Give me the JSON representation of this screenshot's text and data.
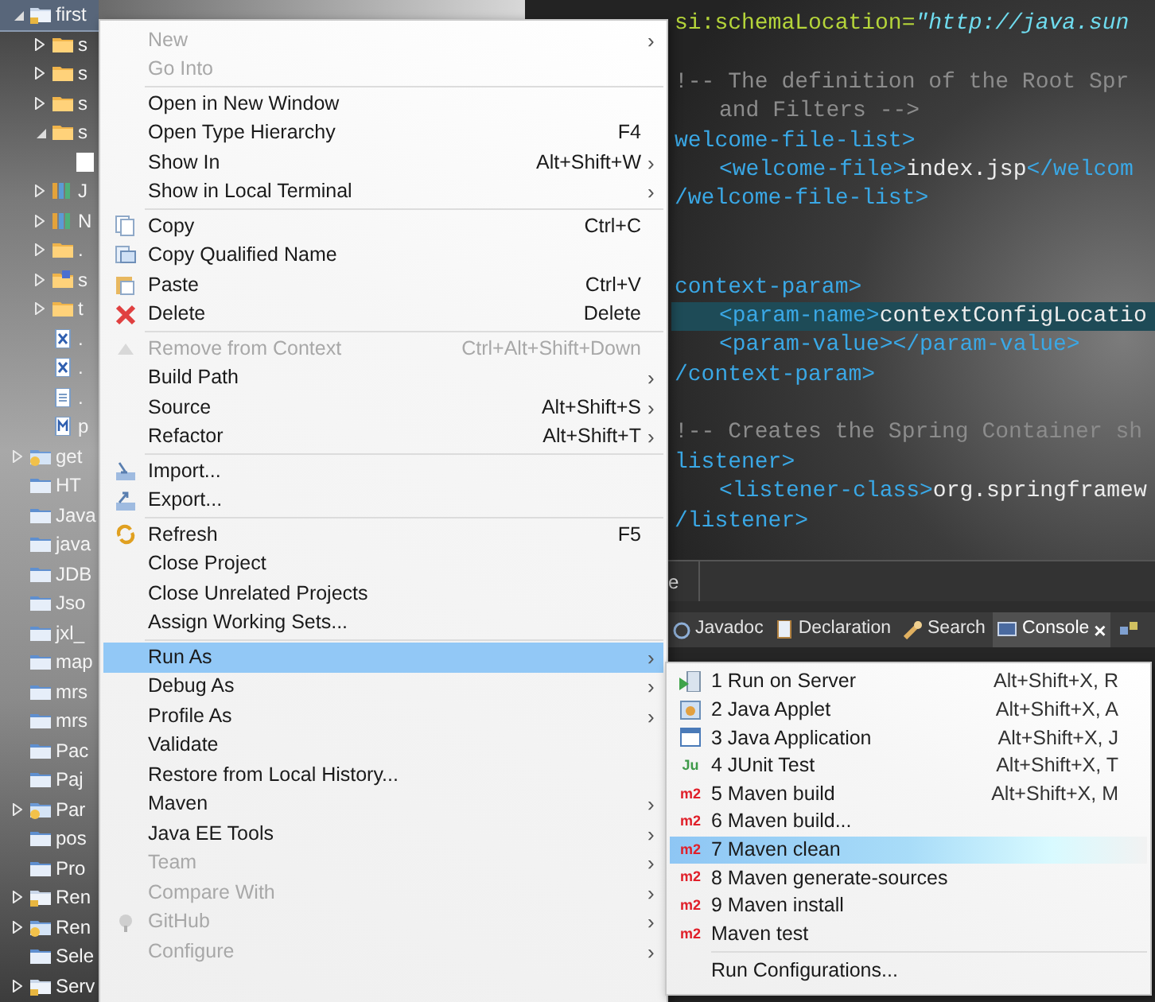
{
  "project_explorer": {
    "items": [
      {
        "label": "first",
        "kind": "project",
        "selected": true,
        "expanded": true,
        "children": [
          {
            "label": "s",
            "kind": "folder",
            "selected": false,
            "expanded": false
          },
          {
            "label": "s",
            "kind": "folder",
            "selected": false,
            "expanded": false
          },
          {
            "label": "s",
            "kind": "folder",
            "selected": false,
            "expanded": false
          },
          {
            "label": "s",
            "kind": "folder",
            "selected": false,
            "expanded": true,
            "children": [
              {
                "kind": "blank",
                "selected": false
              }
            ]
          },
          {
            "label": "J",
            "kind": "library",
            "selected": false,
            "expanded": false
          },
          {
            "label": "N",
            "kind": "library",
            "selected": false,
            "expanded": false
          },
          {
            "label": ".",
            "kind": "folder",
            "selected": false,
            "expanded": false
          },
          {
            "label": "s",
            "kind": "source",
            "selected": false,
            "expanded": false
          },
          {
            "label": "t",
            "kind": "folder",
            "selected": false,
            "expanded": false
          },
          {
            "label": ".",
            "kind": "xml",
            "selected": false
          },
          {
            "label": ".",
            "kind": "xml",
            "selected": false
          },
          {
            "label": ".",
            "kind": "text",
            "selected": false
          },
          {
            "label": "p",
            "kind": "pom",
            "selected": false
          }
        ]
      },
      {
        "label": "get",
        "kind": "maven",
        "selected": false,
        "expanded": false
      },
      {
        "label": "HT",
        "kind": "closed",
        "selected": false
      },
      {
        "label": "Java",
        "kind": "closed",
        "selected": false
      },
      {
        "label": "java",
        "kind": "closed",
        "selected": false
      },
      {
        "label": "JDB",
        "kind": "closed",
        "selected": false
      },
      {
        "label": "Jso",
        "kind": "closed",
        "selected": false
      },
      {
        "label": "jxl_",
        "kind": "closed",
        "selected": false
      },
      {
        "label": "map",
        "kind": "closed",
        "selected": false
      },
      {
        "label": "mrs",
        "kind": "closed",
        "selected": false
      },
      {
        "label": "mrs",
        "kind": "closed",
        "selected": false
      },
      {
        "label": "Pac",
        "kind": "closed",
        "selected": false
      },
      {
        "label": "Paj",
        "kind": "closed",
        "selected": false
      },
      {
        "label": "Par",
        "kind": "maven",
        "selected": false,
        "expanded": false
      },
      {
        "label": "pos",
        "kind": "closed",
        "selected": false
      },
      {
        "label": "Pro",
        "kind": "closed",
        "selected": false
      },
      {
        "label": "Ren",
        "kind": "project",
        "selected": false,
        "expanded": false
      },
      {
        "label": "Ren",
        "kind": "maven",
        "selected": false,
        "expanded": false
      },
      {
        "label": "Sele",
        "kind": "closed",
        "selected": false
      },
      {
        "label": "Serv",
        "kind": "project",
        "selected": false,
        "expanded": false
      }
    ]
  },
  "editor": {
    "lines": [
      {
        "kind": "code",
        "highlighted": false,
        "indented": false,
        "segments": [
          {
            "kind": "attr",
            "text": "si:schemaLocation="
          },
          {
            "kind": "value",
            "text": "\"http://java.sun"
          }
        ]
      },
      {
        "kind": "blank"
      },
      {
        "kind": "code",
        "highlighted": false,
        "indented": false,
        "segments": [
          {
            "kind": "comment",
            "text": "!-- The definition of the Root Spr"
          }
        ]
      },
      {
        "kind": "code",
        "highlighted": false,
        "indented": true,
        "segments": [
          {
            "kind": "comment",
            "text": "and Filters -->"
          }
        ]
      },
      {
        "kind": "code",
        "highlighted": false,
        "indented": false,
        "segments": [
          {
            "kind": "tag",
            "text": "welcome-file-list>"
          }
        ]
      },
      {
        "kind": "code",
        "highlighted": false,
        "indented": true,
        "segments": [
          {
            "kind": "tag",
            "text": "<welcome-file>"
          },
          {
            "kind": "text",
            "text": "index.jsp"
          },
          {
            "kind": "tag",
            "text": "</welcom"
          }
        ]
      },
      {
        "kind": "code",
        "highlighted": false,
        "indented": false,
        "segments": [
          {
            "kind": "tag",
            "text": "/welcome-file-list>"
          }
        ]
      },
      {
        "kind": "blank"
      },
      {
        "kind": "blank"
      },
      {
        "kind": "code",
        "highlighted": false,
        "indented": false,
        "segments": [
          {
            "kind": "tag",
            "text": "context-param>"
          }
        ]
      },
      {
        "kind": "code",
        "highlighted": true,
        "indented": true,
        "segments": [
          {
            "kind": "tag",
            "text": "<param-name>"
          },
          {
            "kind": "text",
            "text": "contextConfigLocatio"
          }
        ]
      },
      {
        "kind": "code",
        "highlighted": false,
        "indented": true,
        "segments": [
          {
            "kind": "tag",
            "text": "<param-value></param-value>"
          }
        ]
      },
      {
        "kind": "code",
        "highlighted": false,
        "indented": false,
        "segments": [
          {
            "kind": "tag",
            "text": "/context-param>"
          }
        ]
      },
      {
        "kind": "blank"
      },
      {
        "kind": "code",
        "highlighted": false,
        "indented": false,
        "segments": [
          {
            "kind": "comment",
            "text": "!-- Creates the Spring Container sh"
          }
        ]
      },
      {
        "kind": "code",
        "highlighted": false,
        "indented": false,
        "segments": [
          {
            "kind": "tag",
            "text": "listener>"
          }
        ]
      },
      {
        "kind": "code",
        "highlighted": false,
        "indented": true,
        "segments": [
          {
            "kind": "tag",
            "text": "<listener-class>"
          },
          {
            "kind": "text",
            "text": "org.springframew"
          }
        ]
      },
      {
        "kind": "code",
        "highlighted": false,
        "indented": false,
        "segments": [
          {
            "kind": "tag",
            "text": "/listener>"
          }
        ]
      }
    ],
    "tabs": [
      {
        "label": "e",
        "selected": false
      }
    ]
  },
  "bottom_panel": {
    "tabs": [
      {
        "label": "Javadoc",
        "selected": false,
        "closable": false
      },
      {
        "label": "Declaration",
        "selected": false,
        "closable": false
      },
      {
        "label": "Search",
        "selected": false,
        "closable": false
      },
      {
        "label": "Console",
        "selected": true,
        "closable": true
      }
    ],
    "close_mark": "×"
  },
  "context_menu": {
    "arrow": "›",
    "items": [
      {
        "kind": "item",
        "label": "New",
        "disabled": true,
        "submenu": true,
        "selected": false
      },
      {
        "kind": "item",
        "label": "Go Into",
        "disabled": true,
        "submenu": false,
        "selected": false
      },
      {
        "kind": "separator"
      },
      {
        "kind": "item",
        "label": "Open in New Window",
        "disabled": false,
        "submenu": false,
        "selected": false
      },
      {
        "kind": "item",
        "label": "Open Type Hierarchy",
        "shortcut": "F4",
        "disabled": false,
        "submenu": false,
        "selected": false
      },
      {
        "kind": "item",
        "label": "Show In",
        "shortcut": "Alt+Shift+W",
        "disabled": false,
        "submenu": true,
        "selected": false
      },
      {
        "kind": "item",
        "label": "Show in Local Terminal",
        "disabled": false,
        "submenu": true,
        "selected": false
      },
      {
        "kind": "separator"
      },
      {
        "kind": "item",
        "label": "Copy",
        "shortcut": "Ctrl+C",
        "disabled": false,
        "submenu": false,
        "selected": false
      },
      {
        "kind": "item",
        "label": "Copy Qualified Name",
        "disabled": false,
        "submenu": false,
        "selected": false
      },
      {
        "kind": "item",
        "label": "Paste",
        "shortcut": "Ctrl+V",
        "disabled": false,
        "submenu": false,
        "selected": false
      },
      {
        "kind": "item",
        "label": "Delete",
        "shortcut": "Delete",
        "disabled": false,
        "submenu": false,
        "selected": false
      },
      {
        "kind": "separator"
      },
      {
        "kind": "item",
        "label": "Remove from Context",
        "shortcut": "Ctrl+Alt+Shift+Down",
        "disabled": true,
        "submenu": false,
        "selected": false
      },
      {
        "kind": "item",
        "label": "Build Path",
        "disabled": false,
        "submenu": true,
        "selected": false
      },
      {
        "kind": "item",
        "label": "Source",
        "shortcut": "Alt+Shift+S",
        "disabled": false,
        "submenu": true,
        "selected": false
      },
      {
        "kind": "item",
        "label": "Refactor",
        "shortcut": "Alt+Shift+T",
        "disabled": false,
        "submenu": true,
        "selected": false
      },
      {
        "kind": "separator"
      },
      {
        "kind": "item",
        "label": "Import...",
        "disabled": false,
        "submenu": false,
        "selected": false
      },
      {
        "kind": "item",
        "label": "Export...",
        "disabled": false,
        "submenu": false,
        "selected": false
      },
      {
        "kind": "separator"
      },
      {
        "kind": "item",
        "label": "Refresh",
        "shortcut": "F5",
        "disabled": false,
        "submenu": false,
        "selected": false
      },
      {
        "kind": "item",
        "label": "Close Project",
        "disabled": false,
        "submenu": false,
        "selected": false
      },
      {
        "kind": "item",
        "label": "Close Unrelated Projects",
        "disabled": false,
        "submenu": false,
        "selected": false
      },
      {
        "kind": "item",
        "label": "Assign Working Sets...",
        "disabled": false,
        "submenu": false,
        "selected": false
      },
      {
        "kind": "separator"
      },
      {
        "kind": "item",
        "label": "Run As",
        "disabled": false,
        "submenu": true,
        "selected": true
      },
      {
        "kind": "item",
        "label": "Debug As",
        "disabled": false,
        "submenu": true,
        "selected": false
      },
      {
        "kind": "item",
        "label": "Profile As",
        "disabled": false,
        "submenu": true,
        "selected": false
      },
      {
        "kind": "item",
        "label": "Validate",
        "disabled": false,
        "submenu": false,
        "selected": false
      },
      {
        "kind": "item",
        "label": "Restore from Local History...",
        "disabled": false,
        "submenu": false,
        "selected": false
      },
      {
        "kind": "item",
        "label": "Maven",
        "disabled": false,
        "submenu": true,
        "selected": false
      },
      {
        "kind": "item",
        "label": "Java EE Tools",
        "disabled": false,
        "submenu": true,
        "selected": false
      },
      {
        "kind": "item",
        "label": "Team",
        "disabled": true,
        "submenu": true,
        "selected": false
      },
      {
        "kind": "item",
        "label": "Compare With",
        "disabled": true,
        "submenu": true,
        "selected": false
      },
      {
        "kind": "item",
        "label": "GitHub",
        "disabled": true,
        "submenu": true,
        "selected": false
      },
      {
        "kind": "item",
        "label": "Configure",
        "disabled": true,
        "submenu": true,
        "selected": false
      }
    ]
  },
  "run_as_submenu": {
    "items": [
      {
        "kind": "item",
        "label": "1 Run on Server",
        "shortcut": "Alt+Shift+X, R",
        "selected": false
      },
      {
        "kind": "item",
        "label": "2 Java Applet",
        "shortcut": "Alt+Shift+X, A",
        "selected": false
      },
      {
        "kind": "item",
        "label": "3 Java Application",
        "shortcut": "Alt+Shift+X, J",
        "selected": false
      },
      {
        "kind": "item",
        "label": "4 JUnit Test",
        "shortcut": "Alt+Shift+X, T",
        "badge": "Ju",
        "selected": false
      },
      {
        "kind": "item",
        "label": "5 Maven build",
        "shortcut": "Alt+Shift+X, M",
        "badge": "m2",
        "selected": false
      },
      {
        "kind": "item",
        "label": "6 Maven build...",
        "badge": "m2",
        "selected": false
      },
      {
        "kind": "item",
        "label": "7 Maven clean",
        "badge": "m2",
        "selected": true
      },
      {
        "kind": "item",
        "label": "8 Maven generate-sources",
        "badge": "m2",
        "selected": false
      },
      {
        "kind": "item",
        "label": "9 Maven install",
        "badge": "m2",
        "selected": false
      },
      {
        "kind": "item",
        "label": "Maven test",
        "badge": "m2",
        "selected": false
      },
      {
        "kind": "separator"
      },
      {
        "kind": "item",
        "label": "Run Configurations...",
        "selected": false
      }
    ]
  }
}
